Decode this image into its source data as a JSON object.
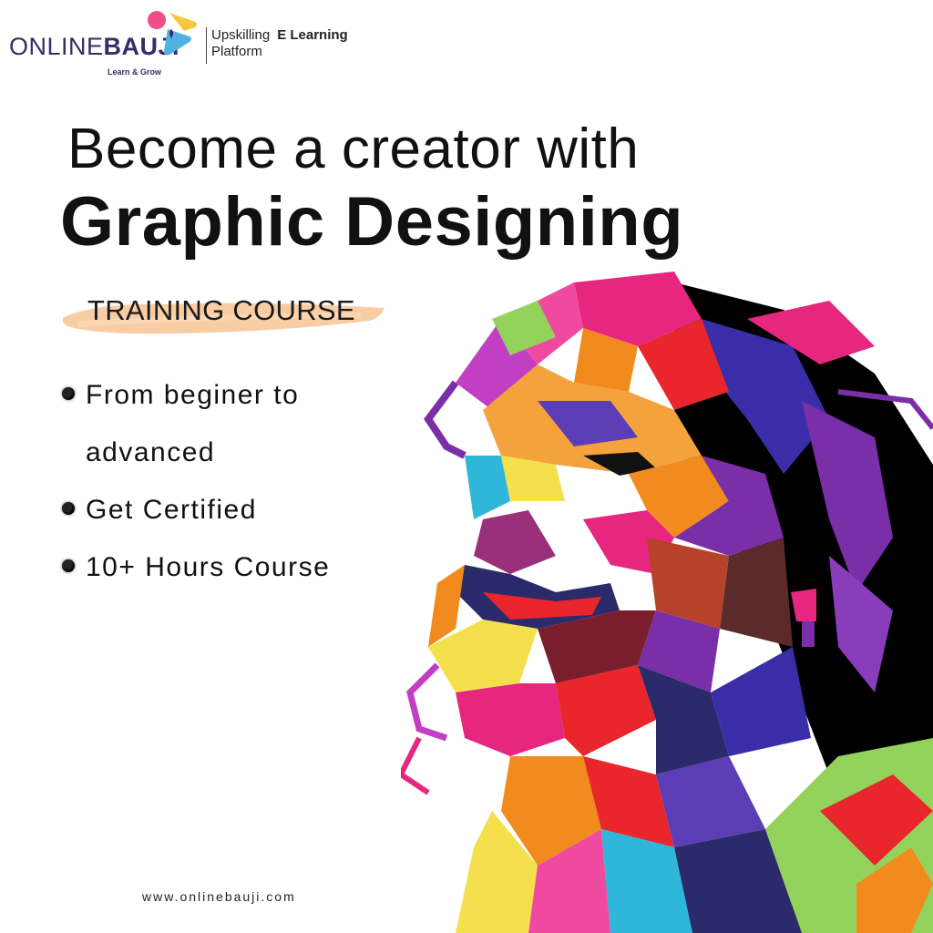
{
  "brand": {
    "name_light": "ONLINE",
    "name_bold": "BAUJI",
    "tagline": "Learn & Grow",
    "subtitle_line1": "Upskilling",
    "subtitle_bold": "E Learning",
    "subtitle_line2": "Platform",
    "colors": {
      "pink": "#ee4f8a",
      "yellow": "#f6c73a",
      "blue": "#4fb2e3",
      "purple": "#3a2a66"
    }
  },
  "headline": {
    "line1": "Become a creator with",
    "line2": "Graphic Designing"
  },
  "course": {
    "label": "TRAINING COURSE",
    "highlight_color": "#f8c89a"
  },
  "features": [
    {
      "text": "From beginer to advanced"
    },
    {
      "text": "Get Certified"
    },
    {
      "text": "10+ Hours Course"
    }
  ],
  "footer": {
    "url": "www.onlinebauji.com"
  },
  "artwork": {
    "icon": "pop-art-portrait",
    "palette": [
      "#e6267f",
      "#7a2fa8",
      "#f28b1e",
      "#f4e04d",
      "#2fb7d9",
      "#e8262b",
      "#93d35c",
      "#2b2a6b",
      "#000000"
    ]
  }
}
